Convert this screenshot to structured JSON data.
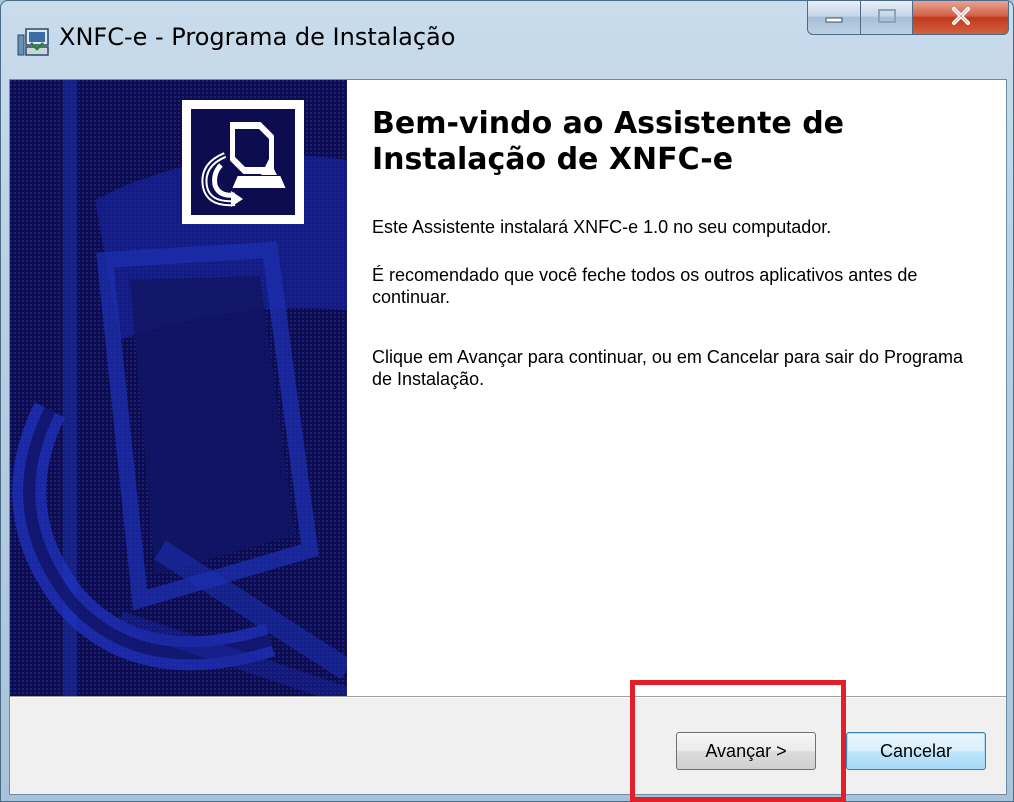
{
  "window": {
    "title": "XNFC-e - Programa de Instalação",
    "icon": "installer-app-icon"
  },
  "caption_buttons": {
    "minimize_icon": "minimize-icon",
    "maximize_icon": "maximize-icon",
    "close_icon": "close-icon",
    "close_color": "#c7412a"
  },
  "banner": {
    "background_color": "#0c0c4e",
    "logo_icon": "computer-install-icon"
  },
  "wizard": {
    "heading": "Bem-vindo ao Assistente de Instalação de XNFC-e",
    "paragraph_1": "Este Assistente instalará XNFC-e 1.0 no seu computador.",
    "paragraph_2": "É recomendado que você feche todos os outros aplicativos antes de continuar.",
    "paragraph_3": "Clique em Avançar para continuar, ou em Cancelar para sair do Programa de Instalação."
  },
  "buttons": {
    "next_label": "Avançar >",
    "cancel_label": "Cancelar"
  },
  "annotation": {
    "highlight_color": "#e3202a"
  }
}
